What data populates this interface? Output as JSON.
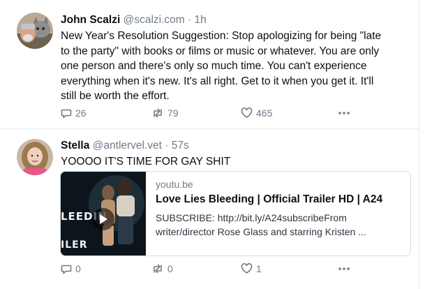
{
  "posts": [
    {
      "author": "John Scalzi",
      "handle": "@scalzi.com",
      "separator": "·",
      "time": "1h",
      "lines": [
        "New Year's Resolution Suggestion: Stop apologizing for being \"late",
        "to the party\" with books or films or music or whatever. You are only",
        "one person and there's only so much time. You can't experience",
        "everything when it's new. It's all right. Get to it when you get it. It'll",
        "still be worth the effort."
      ],
      "replies": "26",
      "reposts": "79",
      "likes": "465"
    },
    {
      "author": "Stella",
      "handle": "@antlervel.vet",
      "separator": "·",
      "time": "57s",
      "lines": [
        "YOOOO IT'S TIME FOR GAY SHIT"
      ],
      "embed": {
        "domain": "youtu.be",
        "title": "Love Lies Bleeding | Official Trailer HD | A24",
        "desc_lines": [
          "SUBSCRIBE: http://bit.ly/A24subscribeFrom",
          "writer/director Rose Glass and starring Kristen ..."
        ],
        "thumb_text_1": "LEEDIN",
        "thumb_text_2": "ILER"
      },
      "replies": "0",
      "reposts": "0",
      "likes": "1"
    }
  ],
  "icons": {
    "reply": "speech-bubble-icon",
    "repost": "repost-arrows-icon",
    "like": "heart-icon",
    "more": "more-dots-icon",
    "play": "play-icon"
  },
  "colors": {
    "text": "#0b0f14",
    "muted": "#6f7b88",
    "divider": "#e2e7ee"
  }
}
